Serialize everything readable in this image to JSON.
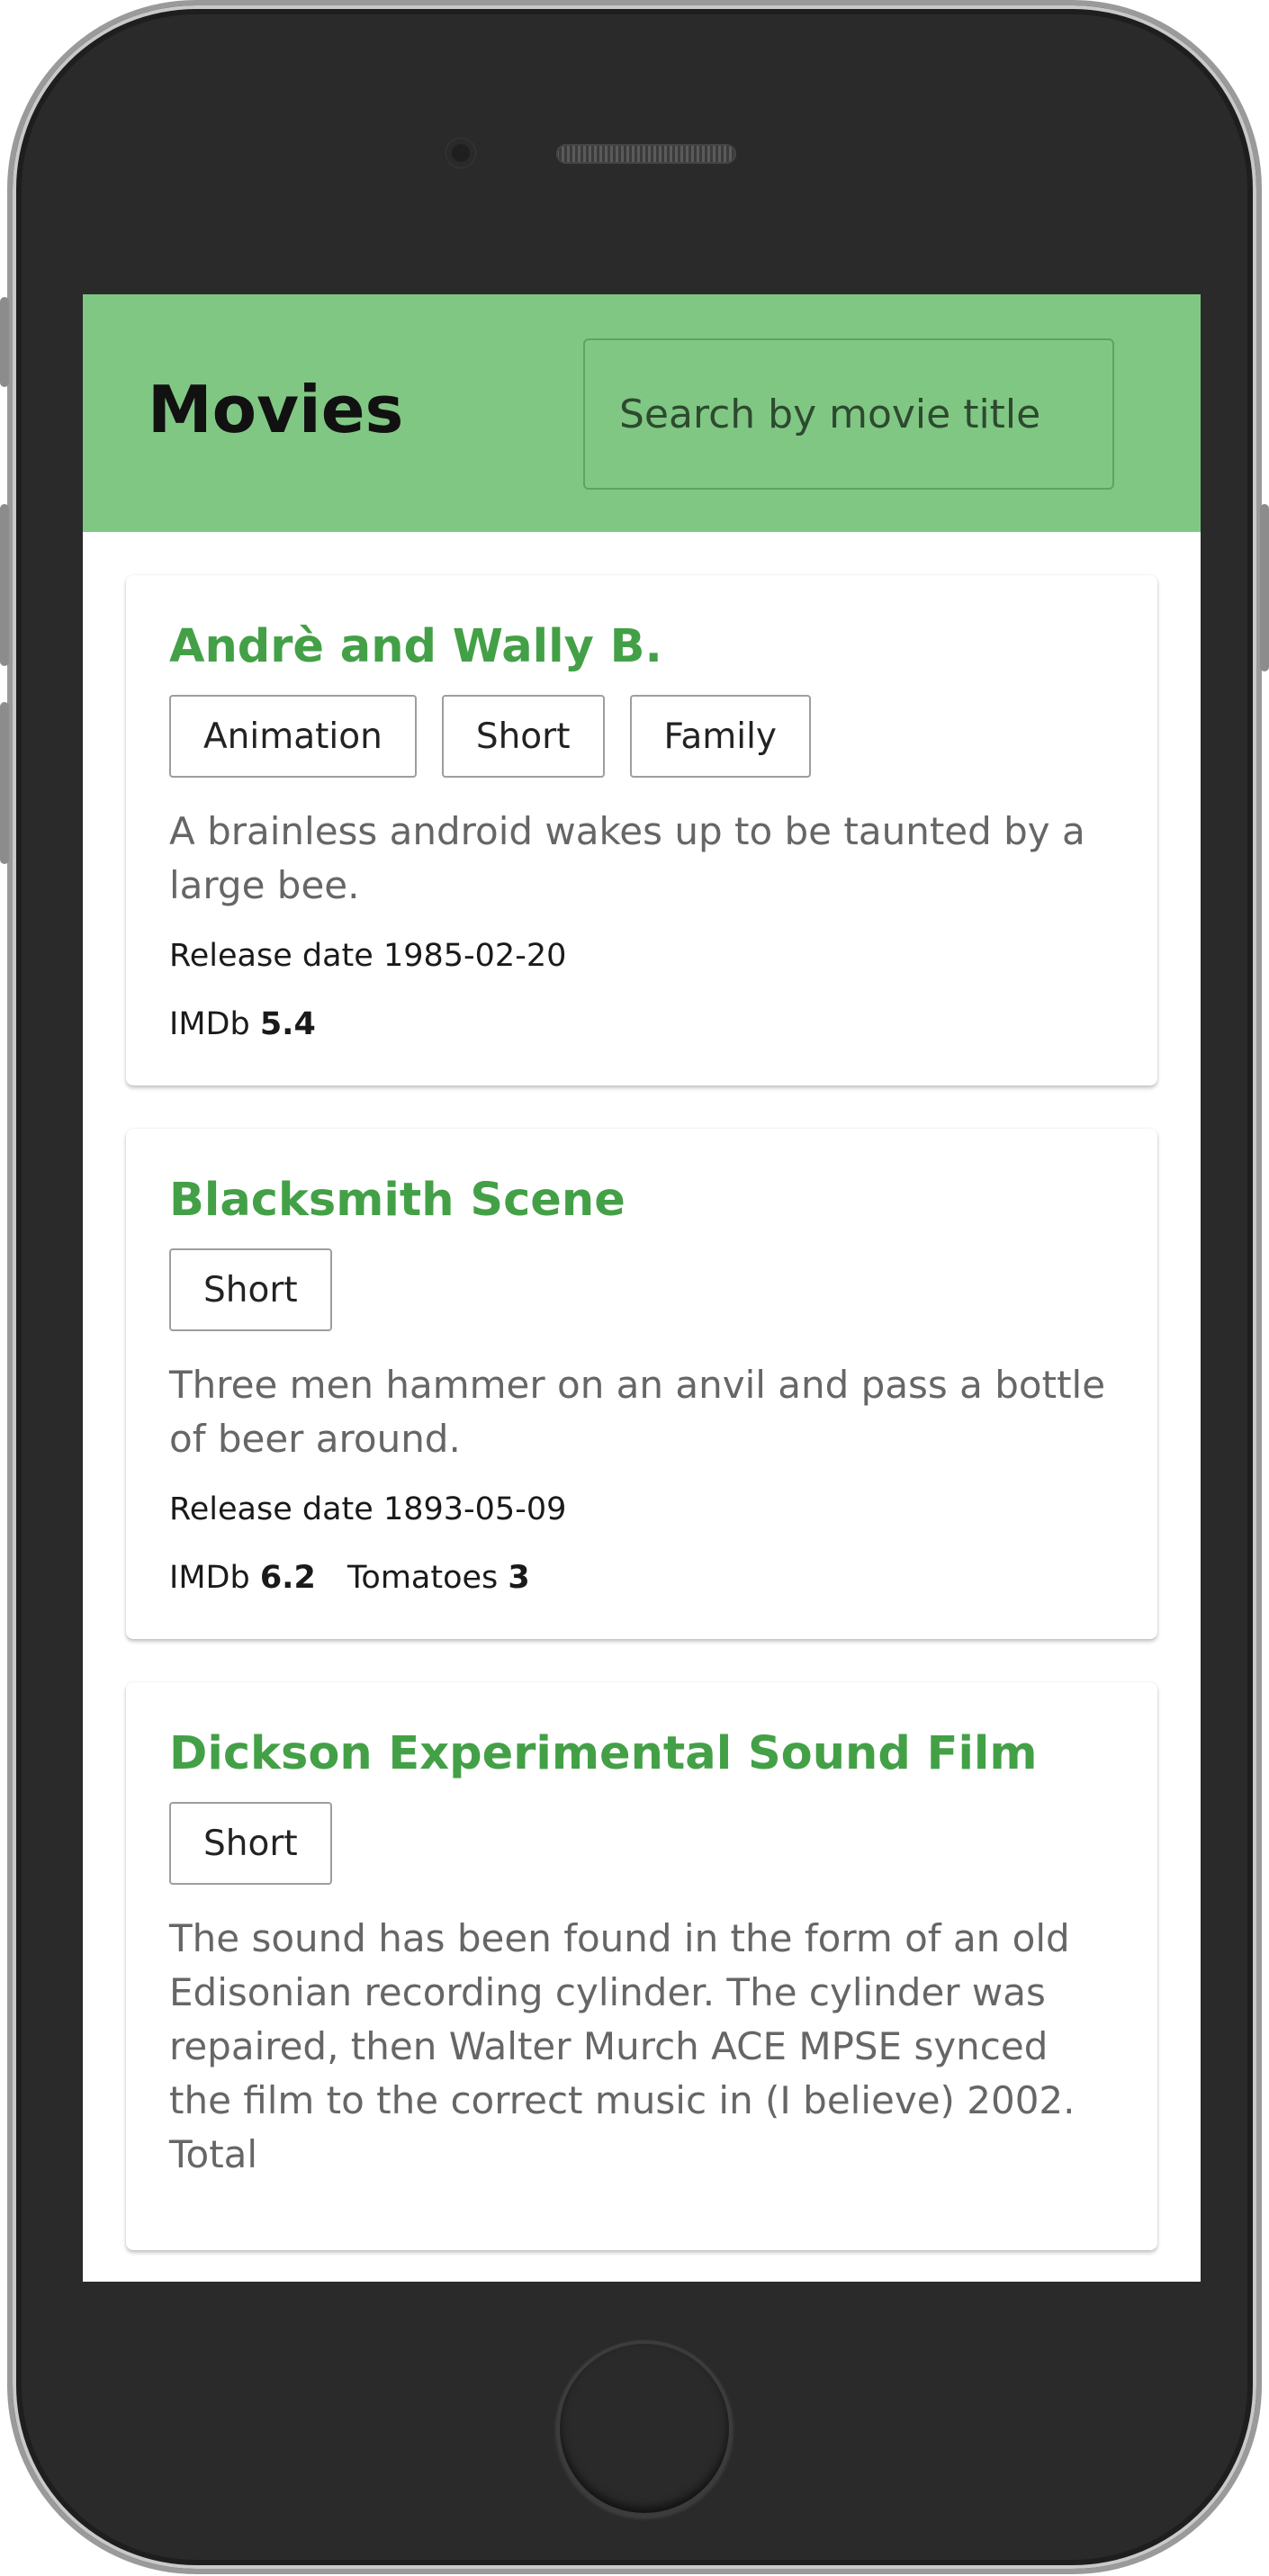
{
  "app": {
    "title": "Movies",
    "search_placeholder": "Search by movie title"
  },
  "movies": [
    {
      "title": "Andrè and Wally B.",
      "genres": [
        "Animation",
        "Short",
        "Family"
      ],
      "plot": "A brainless android wakes up to be taunted by a large bee.",
      "release_label": "Release date",
      "release_date": "1985-02-20",
      "imdb_label": "IMDb",
      "imdb": "5.4"
    },
    {
      "title": "Blacksmith Scene",
      "genres": [
        "Short"
      ],
      "plot": "Three men hammer on an anvil and pass a bottle of beer around.",
      "release_label": "Release date",
      "release_date": "1893-05-09",
      "imdb_label": "IMDb",
      "imdb": "6.2",
      "tomatoes_label": "Tomatoes",
      "tomatoes": "3"
    },
    {
      "title": "Dickson Experimental Sound Film",
      "genres": [
        "Short"
      ],
      "plot": "The sound has been found in the form of an old Edisonian recording cylinder. The cylinder was repaired, then Walter Murch ACE MPSE synced the film to the correct music in (I believe) 2002. Total"
    }
  ],
  "colors": {
    "header_bg": "#81c784",
    "title_green": "#43a047",
    "device_body": "#2a2a2a"
  }
}
